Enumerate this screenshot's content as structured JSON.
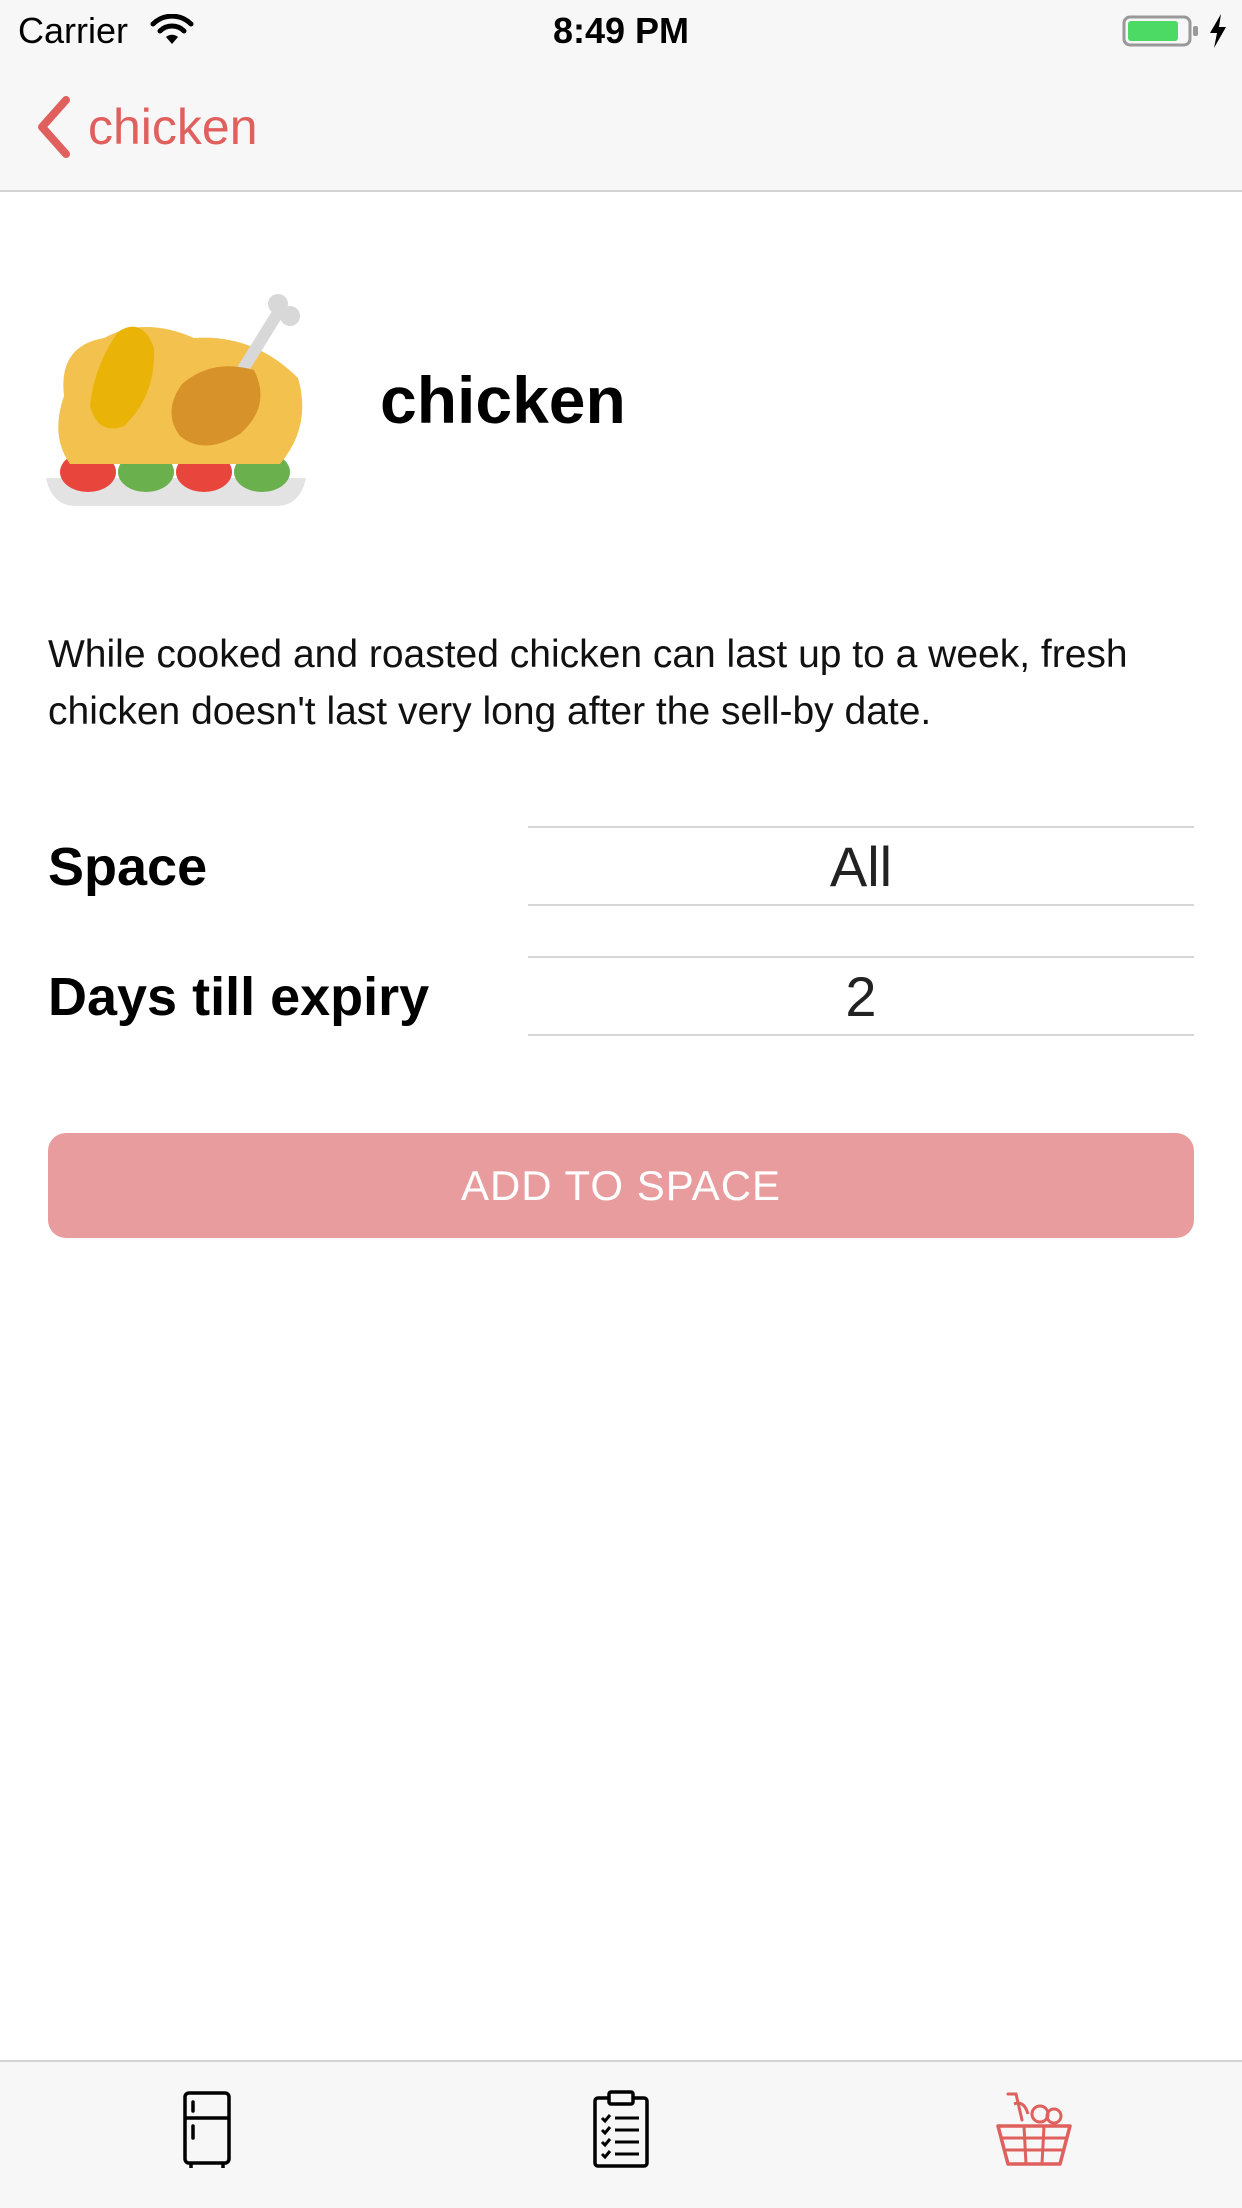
{
  "status_bar": {
    "carrier": "Carrier",
    "time": "8:49 PM",
    "battery_color": "#4cd964"
  },
  "nav": {
    "back_label": "chicken",
    "accent_color": "#e0605e"
  },
  "item": {
    "title": "chicken",
    "icon": "roast-chicken-icon",
    "description": "While cooked and roasted chicken can last up to a week, fresh chicken doesn't last very long after the sell-by date."
  },
  "form": {
    "space_label": "Space",
    "space_value": "All",
    "expiry_label": "Days till expiry",
    "expiry_value": "2",
    "add_button_label": "ADD TO SPACE",
    "add_button_color": "#e89c9d"
  },
  "tab_bar": {
    "tabs": [
      {
        "icon": "fridge-icon",
        "selected": false
      },
      {
        "icon": "clipboard-list-icon",
        "selected": false
      },
      {
        "icon": "basket-icon",
        "selected": true
      }
    ]
  }
}
